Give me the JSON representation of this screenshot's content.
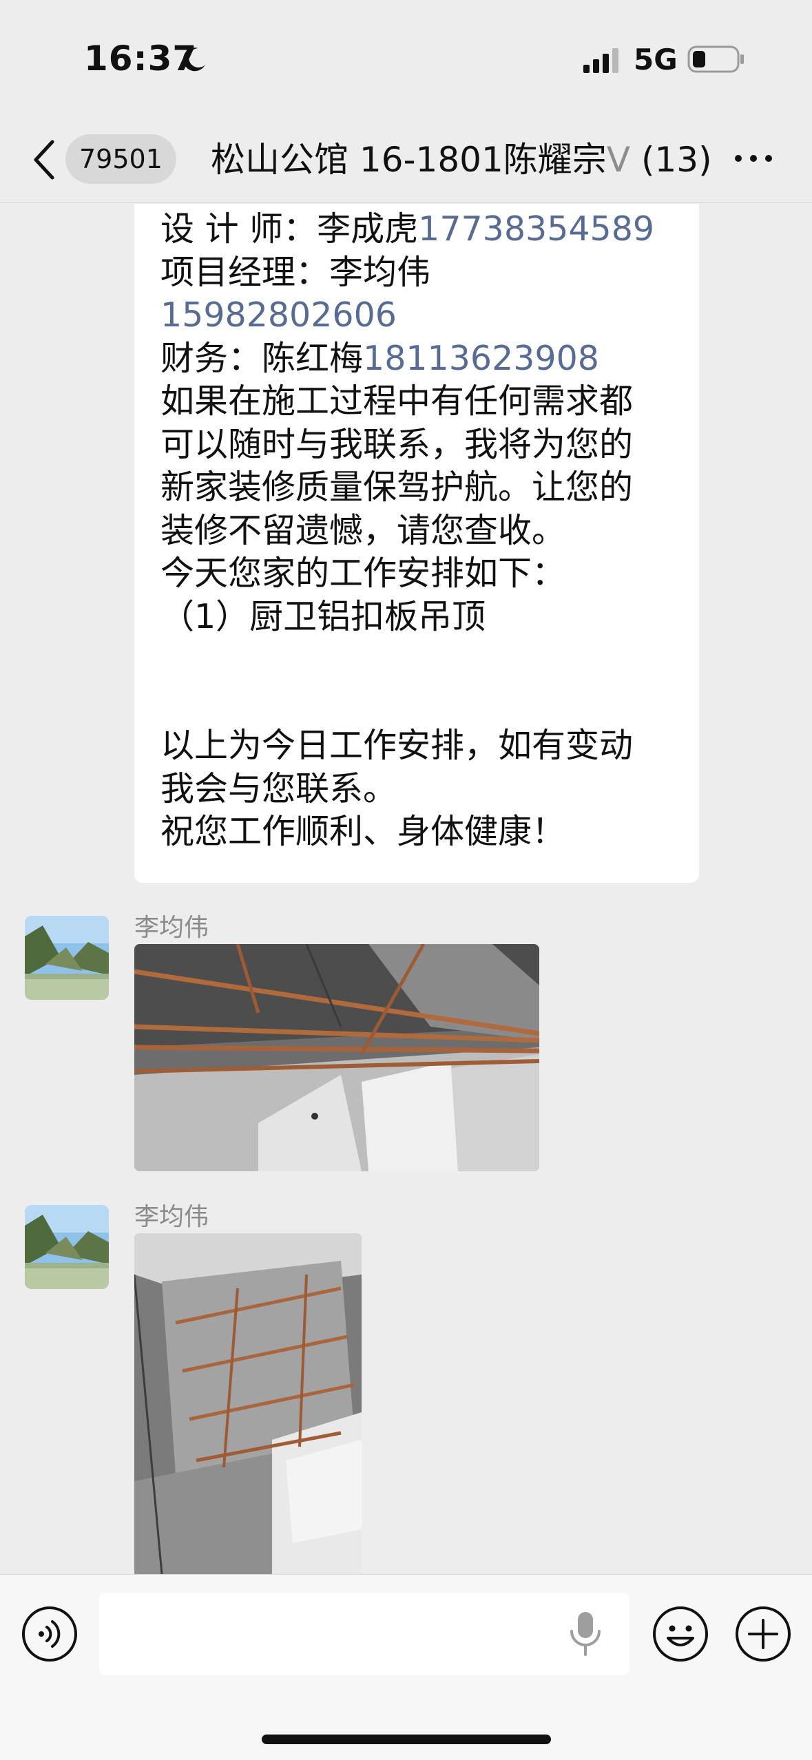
{
  "status_bar": {
    "time": "16:37",
    "network": "5G",
    "icons": [
      "moon-icon",
      "signal-icon",
      "battery-icon"
    ]
  },
  "nav": {
    "unread_count": "79501",
    "title": "松山公馆 16-1801陈耀宗",
    "verified_mark": "V",
    "member_count": "(13)",
    "icons": [
      "chevron-left-icon",
      "more-icon"
    ]
  },
  "text_message": {
    "designer_label": "设 计 师：李成虎",
    "designer_phone": "17738354589",
    "pm_label": "项目经理：李均伟",
    "pm_phone": "15982802606",
    "finance_label": "财务：陈红梅",
    "finance_phone": "18113623908",
    "line_1": "如果在施工过程中有任何需求都",
    "line_2": "可以随时与我联系，我将为您的",
    "line_3": "新家装修质量保驾护航。让您的",
    "line_4": "装修不留遗憾，请您查收。",
    "line_5": "今天您家的工作安排如下：",
    "line_6": "（1）厨卫铝扣板吊顶",
    "line_7": "以上为今日工作安排，如有变动",
    "line_8": "我会与您联系。",
    "line_9": "祝您工作顺利、身体健康！"
  },
  "image_messages": [
    {
      "sender": "李均伟"
    },
    {
      "sender": "李均伟"
    }
  ],
  "input_bar": {
    "placeholder": "",
    "icons": [
      "voice-icon",
      "mic-icon",
      "emoji-icon",
      "plus-icon"
    ]
  },
  "colors": {
    "background": "#ededed",
    "bubble": "#ffffff",
    "link": "#576b95",
    "sender_name": "#8a8a8a"
  }
}
